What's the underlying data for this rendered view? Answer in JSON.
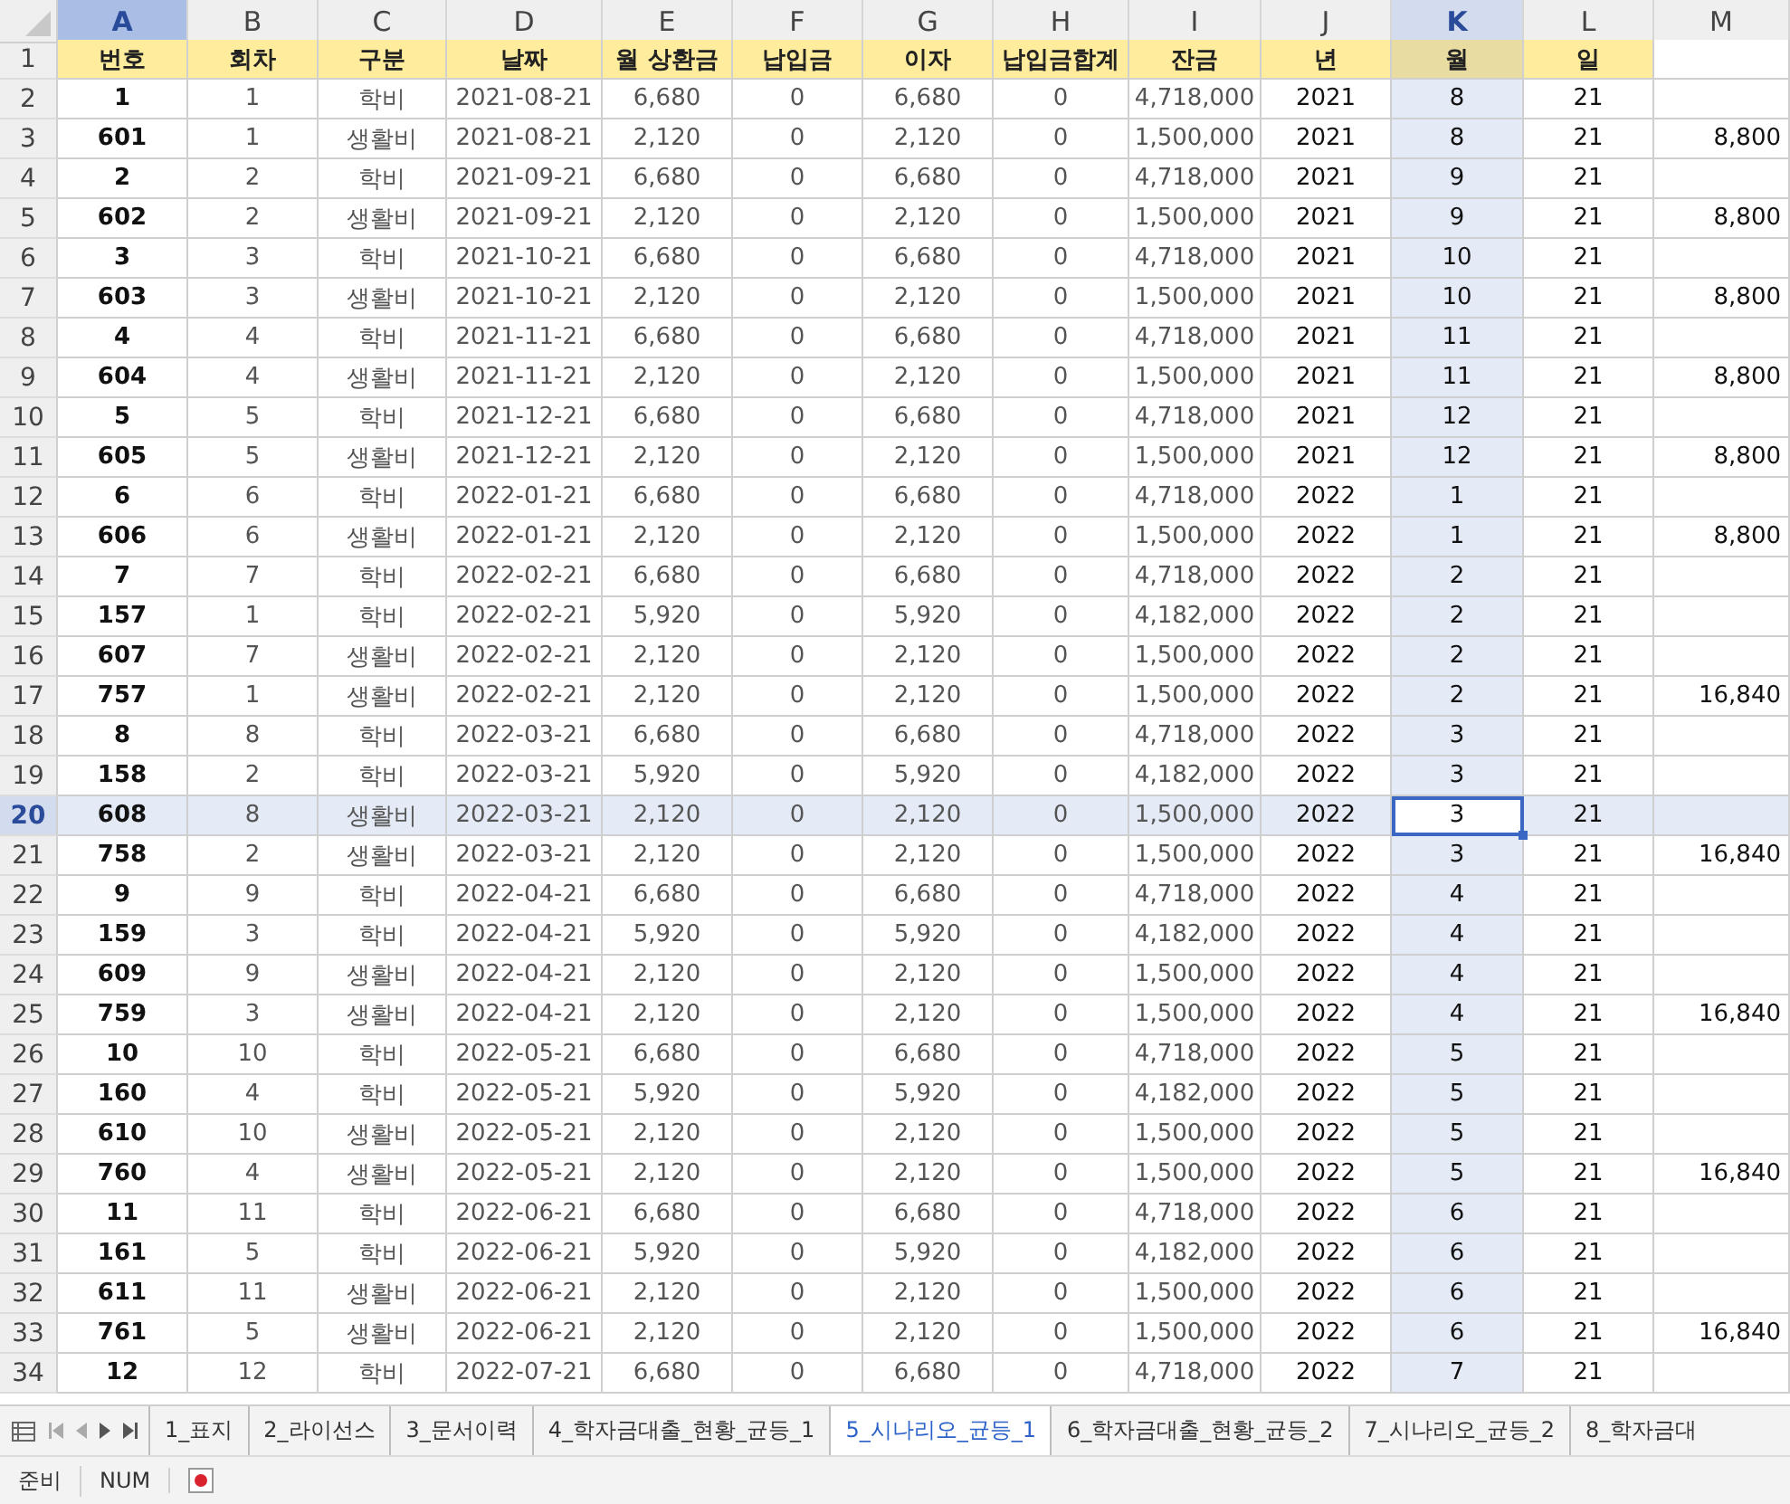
{
  "columns": [
    {
      "letter": "A",
      "selected": false,
      "highlighted": true
    },
    {
      "letter": "B",
      "selected": false,
      "highlighted": false
    },
    {
      "letter": "C",
      "selected": false,
      "highlighted": false
    },
    {
      "letter": "D",
      "selected": false,
      "highlighted": false
    },
    {
      "letter": "E",
      "selected": false,
      "highlighted": false
    },
    {
      "letter": "F",
      "selected": false,
      "highlighted": false
    },
    {
      "letter": "G",
      "selected": false,
      "highlighted": false
    },
    {
      "letter": "H",
      "selected": false,
      "highlighted": false
    },
    {
      "letter": "I",
      "selected": false,
      "highlighted": false
    },
    {
      "letter": "J",
      "selected": false,
      "highlighted": false
    },
    {
      "letter": "K",
      "selected": true,
      "highlighted": false
    },
    {
      "letter": "L",
      "selected": false,
      "highlighted": false
    },
    {
      "letter": "M",
      "selected": false,
      "highlighted": false
    }
  ],
  "header_row": {
    "number": "1",
    "cells": [
      "번호",
      "회차",
      "구분",
      "날짜",
      "월 상환금",
      "납입금",
      "이자",
      "납입금합계",
      "잔금",
      "년",
      "월",
      "일"
    ]
  },
  "rows": [
    {
      "number": "2",
      "selected": false,
      "cells": [
        "1",
        "1",
        "학비",
        "2021-08-21",
        "6,680",
        "0",
        "6,680",
        "0",
        "4,718,000",
        "2021",
        "8",
        "21",
        ""
      ]
    },
    {
      "number": "3",
      "selected": false,
      "cells": [
        "601",
        "1",
        "생활비",
        "2021-08-21",
        "2,120",
        "0",
        "2,120",
        "0",
        "1,500,000",
        "2021",
        "8",
        "21",
        "8,800"
      ]
    },
    {
      "number": "4",
      "selected": false,
      "cells": [
        "2",
        "2",
        "학비",
        "2021-09-21",
        "6,680",
        "0",
        "6,680",
        "0",
        "4,718,000",
        "2021",
        "9",
        "21",
        ""
      ]
    },
    {
      "number": "5",
      "selected": false,
      "cells": [
        "602",
        "2",
        "생활비",
        "2021-09-21",
        "2,120",
        "0",
        "2,120",
        "0",
        "1,500,000",
        "2021",
        "9",
        "21",
        "8,800"
      ]
    },
    {
      "number": "6",
      "selected": false,
      "cells": [
        "3",
        "3",
        "학비",
        "2021-10-21",
        "6,680",
        "0",
        "6,680",
        "0",
        "4,718,000",
        "2021",
        "10",
        "21",
        ""
      ]
    },
    {
      "number": "7",
      "selected": false,
      "cells": [
        "603",
        "3",
        "생활비",
        "2021-10-21",
        "2,120",
        "0",
        "2,120",
        "0",
        "1,500,000",
        "2021",
        "10",
        "21",
        "8,800"
      ]
    },
    {
      "number": "8",
      "selected": false,
      "cells": [
        "4",
        "4",
        "학비",
        "2021-11-21",
        "6,680",
        "0",
        "6,680",
        "0",
        "4,718,000",
        "2021",
        "11",
        "21",
        ""
      ]
    },
    {
      "number": "9",
      "selected": false,
      "cells": [
        "604",
        "4",
        "생활비",
        "2021-11-21",
        "2,120",
        "0",
        "2,120",
        "0",
        "1,500,000",
        "2021",
        "11",
        "21",
        "8,800"
      ]
    },
    {
      "number": "10",
      "selected": false,
      "cells": [
        "5",
        "5",
        "학비",
        "2021-12-21",
        "6,680",
        "0",
        "6,680",
        "0",
        "4,718,000",
        "2021",
        "12",
        "21",
        ""
      ]
    },
    {
      "number": "11",
      "selected": false,
      "cells": [
        "605",
        "5",
        "생활비",
        "2021-12-21",
        "2,120",
        "0",
        "2,120",
        "0",
        "1,500,000",
        "2021",
        "12",
        "21",
        "8,800"
      ]
    },
    {
      "number": "12",
      "selected": false,
      "cells": [
        "6",
        "6",
        "학비",
        "2022-01-21",
        "6,680",
        "0",
        "6,680",
        "0",
        "4,718,000",
        "2022",
        "1",
        "21",
        ""
      ]
    },
    {
      "number": "13",
      "selected": false,
      "cells": [
        "606",
        "6",
        "생활비",
        "2022-01-21",
        "2,120",
        "0",
        "2,120",
        "0",
        "1,500,000",
        "2022",
        "1",
        "21",
        "8,800"
      ]
    },
    {
      "number": "14",
      "selected": false,
      "cells": [
        "7",
        "7",
        "학비",
        "2022-02-21",
        "6,680",
        "0",
        "6,680",
        "0",
        "4,718,000",
        "2022",
        "2",
        "21",
        ""
      ]
    },
    {
      "number": "15",
      "selected": false,
      "cells": [
        "157",
        "1",
        "학비",
        "2022-02-21",
        "5,920",
        "0",
        "5,920",
        "0",
        "4,182,000",
        "2022",
        "2",
        "21",
        ""
      ]
    },
    {
      "number": "16",
      "selected": false,
      "cells": [
        "607",
        "7",
        "생활비",
        "2022-02-21",
        "2,120",
        "0",
        "2,120",
        "0",
        "1,500,000",
        "2022",
        "2",
        "21",
        ""
      ]
    },
    {
      "number": "17",
      "selected": false,
      "cells": [
        "757",
        "1",
        "생활비",
        "2022-02-21",
        "2,120",
        "0",
        "2,120",
        "0",
        "1,500,000",
        "2022",
        "2",
        "21",
        "16,840"
      ]
    },
    {
      "number": "18",
      "selected": false,
      "cells": [
        "8",
        "8",
        "학비",
        "2022-03-21",
        "6,680",
        "0",
        "6,680",
        "0",
        "4,718,000",
        "2022",
        "3",
        "21",
        ""
      ]
    },
    {
      "number": "19",
      "selected": false,
      "cells": [
        "158",
        "2",
        "학비",
        "2022-03-21",
        "5,920",
        "0",
        "5,920",
        "0",
        "4,182,000",
        "2022",
        "3",
        "21",
        ""
      ]
    },
    {
      "number": "20",
      "selected": true,
      "cells": [
        "608",
        "8",
        "생활비",
        "2022-03-21",
        "2,120",
        "0",
        "2,120",
        "0",
        "1,500,000",
        "2022",
        "3",
        "21",
        ""
      ]
    },
    {
      "number": "21",
      "selected": false,
      "cells": [
        "758",
        "2",
        "생활비",
        "2022-03-21",
        "2,120",
        "0",
        "2,120",
        "0",
        "1,500,000",
        "2022",
        "3",
        "21",
        "16,840"
      ]
    },
    {
      "number": "22",
      "selected": false,
      "cells": [
        "9",
        "9",
        "학비",
        "2022-04-21",
        "6,680",
        "0",
        "6,680",
        "0",
        "4,718,000",
        "2022",
        "4",
        "21",
        ""
      ]
    },
    {
      "number": "23",
      "selected": false,
      "cells": [
        "159",
        "3",
        "학비",
        "2022-04-21",
        "5,920",
        "0",
        "5,920",
        "0",
        "4,182,000",
        "2022",
        "4",
        "21",
        ""
      ]
    },
    {
      "number": "24",
      "selected": false,
      "cells": [
        "609",
        "9",
        "생활비",
        "2022-04-21",
        "2,120",
        "0",
        "2,120",
        "0",
        "1,500,000",
        "2022",
        "4",
        "21",
        ""
      ]
    },
    {
      "number": "25",
      "selected": false,
      "cells": [
        "759",
        "3",
        "생활비",
        "2022-04-21",
        "2,120",
        "0",
        "2,120",
        "0",
        "1,500,000",
        "2022",
        "4",
        "21",
        "16,840"
      ]
    },
    {
      "number": "26",
      "selected": false,
      "cells": [
        "10",
        "10",
        "학비",
        "2022-05-21",
        "6,680",
        "0",
        "6,680",
        "0",
        "4,718,000",
        "2022",
        "5",
        "21",
        ""
      ]
    },
    {
      "number": "27",
      "selected": false,
      "cells": [
        "160",
        "4",
        "학비",
        "2022-05-21",
        "5,920",
        "0",
        "5,920",
        "0",
        "4,182,000",
        "2022",
        "5",
        "21",
        ""
      ]
    },
    {
      "number": "28",
      "selected": false,
      "cells": [
        "610",
        "10",
        "생활비",
        "2022-05-21",
        "2,120",
        "0",
        "2,120",
        "0",
        "1,500,000",
        "2022",
        "5",
        "21",
        ""
      ]
    },
    {
      "number": "29",
      "selected": false,
      "cells": [
        "760",
        "4",
        "생활비",
        "2022-05-21",
        "2,120",
        "0",
        "2,120",
        "0",
        "1,500,000",
        "2022",
        "5",
        "21",
        "16,840"
      ]
    },
    {
      "number": "30",
      "selected": false,
      "cells": [
        "11",
        "11",
        "학비",
        "2022-06-21",
        "6,680",
        "0",
        "6,680",
        "0",
        "4,718,000",
        "2022",
        "6",
        "21",
        ""
      ]
    },
    {
      "number": "31",
      "selected": false,
      "cells": [
        "161",
        "5",
        "학비",
        "2022-06-21",
        "5,920",
        "0",
        "5,920",
        "0",
        "4,182,000",
        "2022",
        "6",
        "21",
        ""
      ]
    },
    {
      "number": "32",
      "selected": false,
      "cells": [
        "611",
        "11",
        "생활비",
        "2022-06-21",
        "2,120",
        "0",
        "2,120",
        "0",
        "1,500,000",
        "2022",
        "6",
        "21",
        ""
      ]
    },
    {
      "number": "33",
      "selected": false,
      "cells": [
        "761",
        "5",
        "생활비",
        "2022-06-21",
        "2,120",
        "0",
        "2,120",
        "0",
        "1,500,000",
        "2022",
        "6",
        "21",
        "16,840"
      ]
    },
    {
      "number": "34",
      "selected": false,
      "cells": [
        "12",
        "12",
        "학비",
        "2022-07-21",
        "6,680",
        "0",
        "6,680",
        "0",
        "4,718,000",
        "2022",
        "7",
        "21",
        ""
      ]
    }
  ],
  "sheet_tabs": [
    {
      "label": "1_표지",
      "selected": false
    },
    {
      "label": "2_라이선스",
      "selected": false
    },
    {
      "label": "3_문서이력",
      "selected": false
    },
    {
      "label": "4_학자금대출_현황_균등_1",
      "selected": false
    },
    {
      "label": "5_시나리오_균등_1",
      "selected": true
    },
    {
      "label": "6_학자금대출_현황_균등_2",
      "selected": false
    },
    {
      "label": "7_시나리오_균등_2",
      "selected": false
    },
    {
      "label": "8_학자금대",
      "selected": false
    }
  ],
  "status_bar": {
    "mode": "준비",
    "num_lock": "NUM",
    "recording": true
  }
}
